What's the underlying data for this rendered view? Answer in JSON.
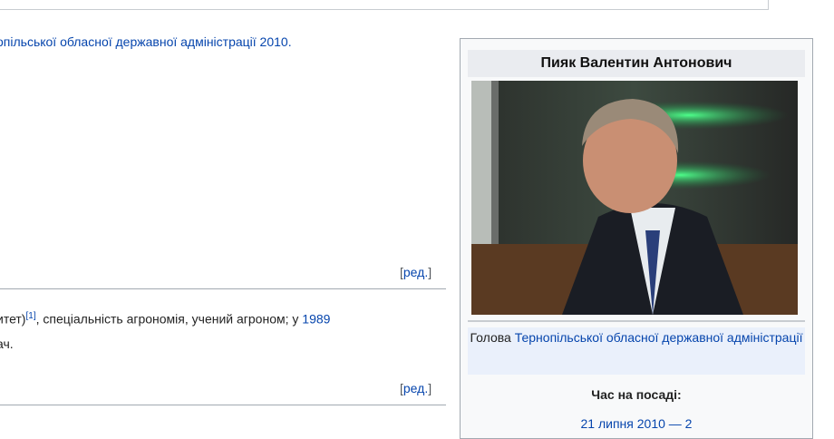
{
  "article": {
    "line1": "опільської обласної державної адміністрації 2010.",
    "para1": {
      "before": "итет)",
      "ref": "[1]",
      "middle": ", спеціальність агрономія, учений агроном; у ",
      "year": "1989"
    },
    "para2": "ач.",
    "edit_open": "[",
    "edit_label": "ред.",
    "edit_close": "]"
  },
  "infobox": {
    "title": "Пияк Валентин Антонович",
    "role_prefix": "Голова ",
    "role_link": "Тернопільської обласної державної адміністрації",
    "term_label": "Час на посаді:",
    "term_value_cut": "21 липня 2010 — 2"
  }
}
